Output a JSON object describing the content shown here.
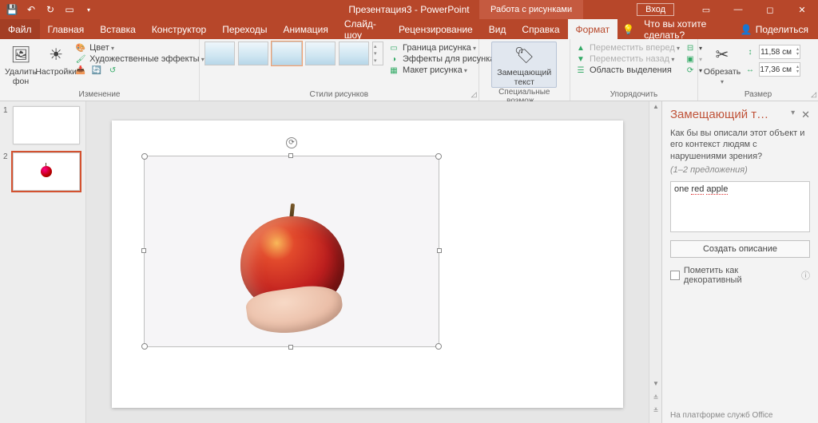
{
  "title": "Презентация3 - PowerPoint",
  "context_tab": "Работа с рисунками",
  "signin": "Вход",
  "share": "Поделиться",
  "tellme": "Что вы хотите сделать?",
  "tabs": {
    "file": "Файл",
    "home": "Главная",
    "insert": "Вставка",
    "design": "Конструктор",
    "transitions": "Переходы",
    "animations": "Анимация",
    "slideshow": "Слайд-шоу",
    "review": "Рецензирование",
    "view": "Вид",
    "help": "Справка",
    "format": "Формат"
  },
  "ribbon": {
    "adjust": {
      "remove_bg": "Удалить фон",
      "corrections": "Настройки",
      "color": "Цвет",
      "artistic": "Художественные эффекты",
      "label": "Изменение"
    },
    "styles": {
      "border": "Граница рисунка",
      "effects": "Эффекты для рисунка",
      "layout": "Макет рисунка",
      "label": "Стили рисунков"
    },
    "access": {
      "alt_text": "Замещающий текст",
      "label": "Специальные возмож…"
    },
    "arrange": {
      "forward": "Переместить вперед",
      "backward": "Переместить назад",
      "selection": "Область выделения",
      "label": "Упорядочить"
    },
    "size": {
      "crop": "Обрезать",
      "height": "11,58 см",
      "width": "17,36 см",
      "label": "Размер"
    }
  },
  "slides": {
    "n1": "1",
    "n2": "2"
  },
  "pane": {
    "title": "Замещающий т…",
    "desc": "Как бы вы описали этот объект и его контекст людям с нарушениями зрения?",
    "hint": "(1–2 предложения)",
    "value": "one red apple",
    "generate": "Создать описание",
    "decorative": "Пометить как декоративный",
    "footer": "На платформе служб Office"
  }
}
